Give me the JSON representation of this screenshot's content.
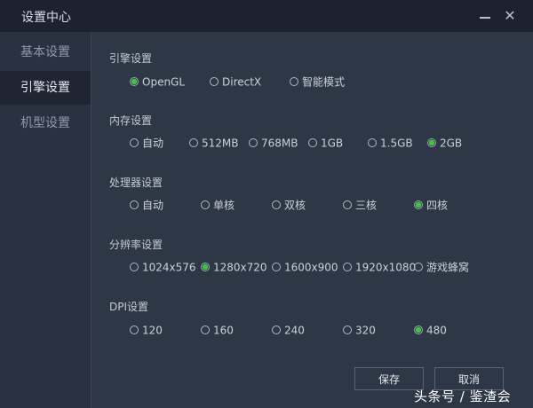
{
  "window": {
    "title": "设置中心",
    "minimize_icon": "minimize-icon",
    "close_icon": "close-icon"
  },
  "sidebar": {
    "items": [
      {
        "label": "基本设置",
        "active": false
      },
      {
        "label": "引擎设置",
        "active": true
      },
      {
        "label": "机型设置",
        "active": false
      }
    ]
  },
  "sections": {
    "engine": {
      "title": "引擎设置",
      "options": [
        "OpenGL",
        "DirectX",
        "智能模式"
      ],
      "selected": "OpenGL"
    },
    "memory": {
      "title": "内存设置",
      "options": [
        "自动",
        "512MB",
        "768MB",
        "1GB",
        "1.5GB",
        "2GB"
      ],
      "selected": "2GB"
    },
    "cpu": {
      "title": "处理器设置",
      "options": [
        "自动",
        "单核",
        "双核",
        "三核",
        "四核"
      ],
      "selected": "四核"
    },
    "resolution": {
      "title": "分辨率设置",
      "options": [
        "1024x576",
        "1280x720",
        "1600x900",
        "1920x1080",
        "游戏蜂窝"
      ],
      "selected": "1280x720"
    },
    "dpi": {
      "title": "DPI设置",
      "options": [
        "120",
        "160",
        "240",
        "320",
        "480"
      ],
      "selected": "480"
    }
  },
  "buttons": {
    "save": "保存",
    "cancel": "取消"
  },
  "watermark": "头条号 / 鉴渣会",
  "colors": {
    "selected_radio": "#3ec43e",
    "titlebar": "#1d2230",
    "panel": "#2e3746"
  }
}
